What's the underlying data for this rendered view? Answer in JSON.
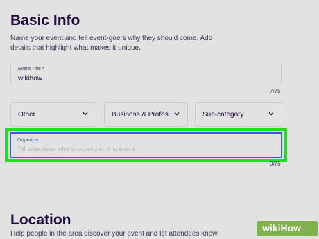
{
  "basic_info": {
    "heading": "Basic Info",
    "description": "Name your event and tell event-goers why they should come. Add details that highlight what makes it unique.",
    "event_title": {
      "label": "Event Title *",
      "value": "wikihow",
      "counter": "7/75"
    },
    "selects": [
      {
        "value": "Other"
      },
      {
        "value": "Business & Profes..."
      },
      {
        "value": "Sub-category"
      }
    ],
    "organizer": {
      "label": "Organizer",
      "placeholder": "Tell attendees who is organizing this event.",
      "counter": "0/75"
    }
  },
  "location": {
    "heading": "Location",
    "description": "Help people in the area discover your event and let attendees know"
  },
  "watermark": "wikiHow",
  "colors": {
    "highlight": "#1be21b",
    "focus": "#3b5bdb",
    "text": "#1e0a3c"
  }
}
